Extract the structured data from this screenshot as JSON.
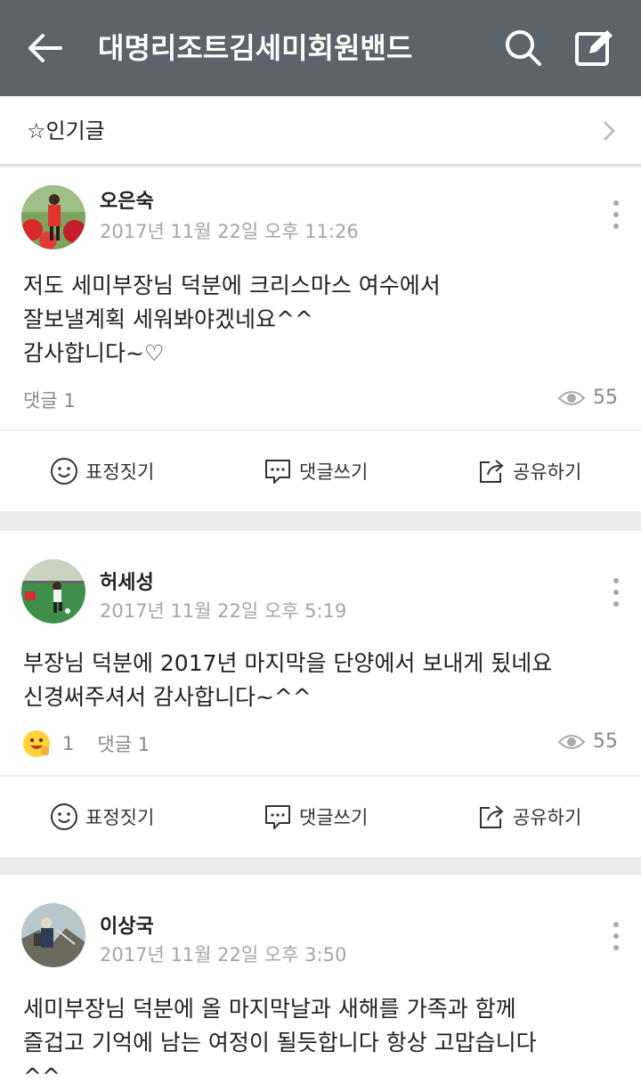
{
  "appbar": {
    "title": "대명리조트김세미회원밴드",
    "bg_color": "#5d636a",
    "icons": [
      "back-arrow-icon",
      "search-icon",
      "write-icon"
    ]
  },
  "popular": {
    "label": "☆인기글"
  },
  "actions": {
    "emotion": "표정짓기",
    "comment": "댓글쓰기",
    "share": "공유하기"
  },
  "posts": [
    {
      "author": "오은숙",
      "date": "2017년 11월 22일 오후 11:26",
      "body": "저도  세미부장님 덕분에 크리스마스 여수에서\n잘보낼계획 세워봐야겠네요^^\n감사합니다~♡",
      "comments": "댓글 1",
      "views": "55"
    },
    {
      "author": "허세성",
      "date": "2017년 11월 22일 오후 5:19",
      "body": "부장님 덕분에 2017년 마지막을 단양에서 보내게 됬네요\n신경써주셔서 감사합니다~^^",
      "reactions": "1",
      "comments": "댓글 1",
      "views": "55"
    },
    {
      "author": "이상국",
      "date": "2017년 11월 22일 오후 3:50",
      "body": "세미부장님 덕분에 올 마지막날과 새해를  가족과 함께\n즐겁고 기억에 남는 여정이  될듯합니다 항상 고맙습니다\n^^"
    }
  ]
}
